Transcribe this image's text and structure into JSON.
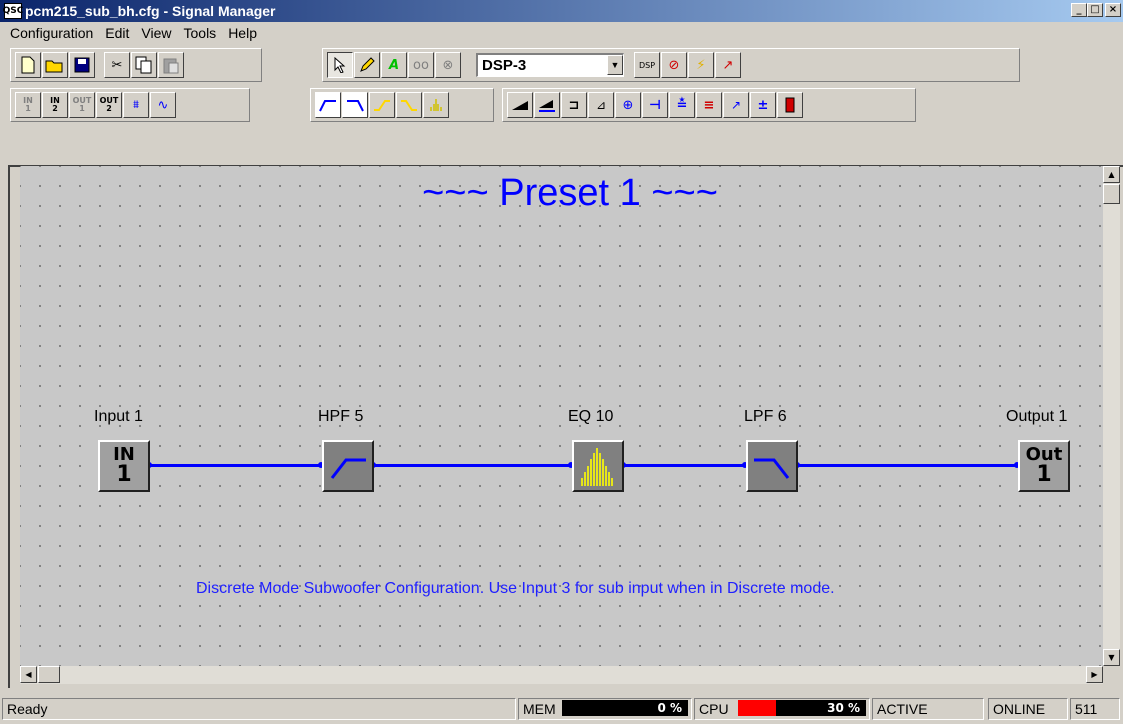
{
  "window": {
    "app_icon": "QSC",
    "title": "pcm215_sub_bh.cfg - Signal Manager",
    "buttons": [
      "minimize-icon",
      "maximize-icon",
      "close-icon"
    ]
  },
  "menu": [
    "Configuration",
    "Edit",
    "View",
    "Tools",
    "Help"
  ],
  "toolbar": {
    "dsp_select": "DSP-3",
    "row2_text": {
      "in1": "IN\n1",
      "in2": "IN\n2",
      "out1": "OUT\n1",
      "out2": "OUT\n2"
    }
  },
  "canvas": {
    "preset_title": "~~~ Preset 1 ~~~",
    "nodes": {
      "input": {
        "label": "Input 1",
        "top": "IN",
        "bottom": "1"
      },
      "hpf": {
        "label": "HPF 5"
      },
      "eq": {
        "label": "EQ 10"
      },
      "lpf": {
        "label": "LPF 6"
      },
      "output": {
        "label": "Output 1",
        "top": "Out",
        "bottom": "1"
      }
    },
    "note": "Discrete Mode Subwoofer Configuration. Use Input 3 for sub input when in Discrete mode."
  },
  "status": {
    "ready": "Ready",
    "mem_label": "MEM",
    "mem_value": "0 %",
    "cpu_label": "CPU",
    "cpu_value": "30 %",
    "cpu_level": 0.3,
    "active": "ACTIVE",
    "online": "ONLINE",
    "count": "511"
  },
  "colors": {
    "wire": "#0000ff",
    "title_text": "#0000ff",
    "eq_bars": "#ffff00",
    "cpu_meter": "#ff0000"
  }
}
